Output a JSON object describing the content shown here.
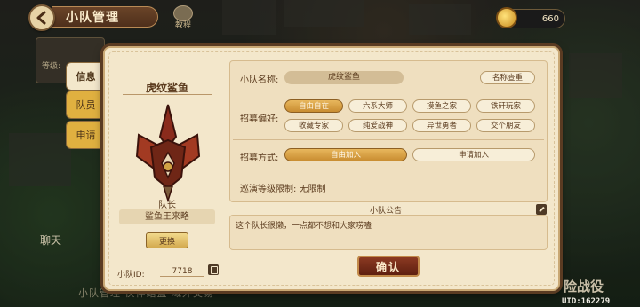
{
  "header": {
    "title": "小队管理",
    "tutorial_label": "教程",
    "coins": "660"
  },
  "background": {
    "side_label": "等级:",
    "chat_label": "聊天",
    "bottom_text": "小队管理  伙伴结盟  域外交易",
    "right_label": "险战役",
    "uid": "UID:162279"
  },
  "tabs": [
    {
      "label": "信息",
      "active": true
    },
    {
      "label": "队员",
      "active": false
    },
    {
      "label": "申请",
      "active": false
    }
  ],
  "team": {
    "name": "虎纹鲨鱼",
    "leader_label": "队长",
    "leader_name": "鲨鱼王来略",
    "change_label": "更换",
    "id_label": "小队ID:",
    "id_value": "7718"
  },
  "form": {
    "name_label": "小队名称:",
    "name_value": "虎纹鲨鱼",
    "check_label": "名称查重",
    "pref_label": "招募偏好:",
    "prefs": [
      {
        "label": "自由自在",
        "selected": true
      },
      {
        "label": "六系大师",
        "selected": false
      },
      {
        "label": "摸鱼之家",
        "selected": false
      },
      {
        "label": "铁矸玩家",
        "selected": false
      },
      {
        "label": "收藏专家",
        "selected": false
      },
      {
        "label": "纯爱战神",
        "selected": false
      },
      {
        "label": "异世勇者",
        "selected": false
      },
      {
        "label": "交个朋友",
        "selected": false
      }
    ],
    "method_label": "招募方式:",
    "methods": [
      {
        "label": "自由加入",
        "selected": true
      },
      {
        "label": "申请加入",
        "selected": false
      }
    ],
    "patrol_label": "巡演等级限制: 无限制"
  },
  "notice": {
    "title": "小队公告",
    "text": "这个队长很懒，一点都不想和大家唠嗑"
  },
  "confirm_label": "确认",
  "colors": {
    "panel": "#f3e7cb",
    "selected_pill": "#d69f42",
    "confirm": "#7a2f1b"
  }
}
